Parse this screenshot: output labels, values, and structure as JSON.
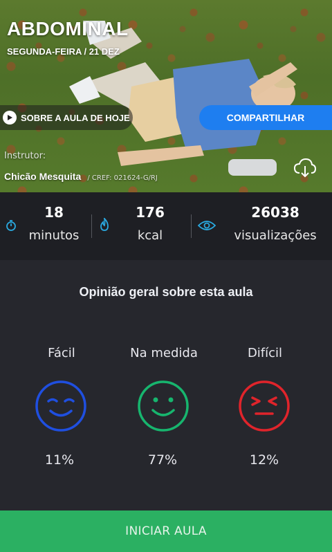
{
  "hero": {
    "title": "ABDOMINAL",
    "date": "SEGUNDA-FEIRA / 21 DEZ",
    "about_label": "SOBRE A AULA DE HOJE",
    "share_label": "COMPARTILHAR",
    "instructor_label": "Instrutor:",
    "instructor_name": "Chicão Mesquita",
    "instructor_cref": "/ CREF: 021624-G/RJ",
    "accent": "#1e7ef0"
  },
  "stats": [
    {
      "value": "18",
      "unit": "minutos",
      "icon": "stopwatch-icon"
    },
    {
      "value": "176",
      "unit": "kcal",
      "icon": "flame-icon"
    },
    {
      "value": "26038",
      "unit": "visualizações",
      "icon": "eye-icon"
    }
  ],
  "stats_icon_color": "#2aa9e0",
  "opinion": {
    "title": "Opinião geral sobre esta aula",
    "options": [
      {
        "label": "Fácil",
        "percent": "11%",
        "color": "#1f4fe0",
        "icon": "wink-face-icon"
      },
      {
        "label": "Na medida",
        "percent": "77%",
        "color": "#17b56e",
        "icon": "smile-face-icon"
      },
      {
        "label": "Difícil",
        "percent": "12%",
        "color": "#e0242b",
        "icon": "strain-face-icon"
      }
    ]
  },
  "start": {
    "label": "INICIAR AULA",
    "color": "#2bb062"
  }
}
